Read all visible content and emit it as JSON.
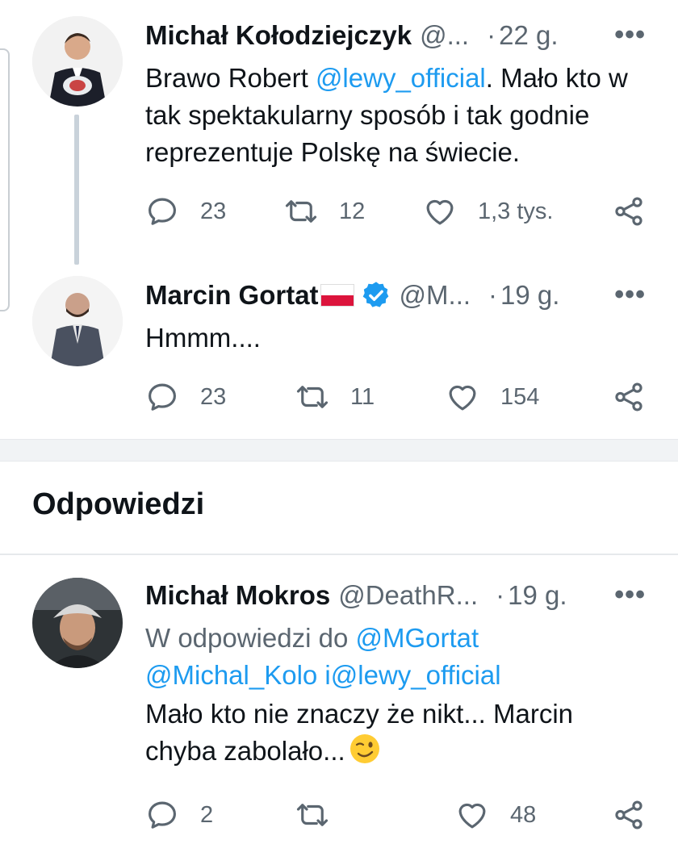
{
  "colors": {
    "link": "#1d9bf0",
    "muted": "#5b6670",
    "text": "#0f1419",
    "verified": "#1d9bf0",
    "flag_red": "#dc143c"
  },
  "tweets": [
    {
      "name": "Michał Kołodziejczyk",
      "handle": "@...",
      "dot": "·",
      "time": "22 g.",
      "more": "•••",
      "text_before": "Brawo Robert ",
      "mention": "@lewy_official",
      "text_after": ". Mało kto w tak spektakularny sposób i tak godnie reprezentuje Polskę na świecie.",
      "replies": "23",
      "retweets": "12",
      "likes": "1,3 tys."
    },
    {
      "name": "Marcin Gortat",
      "handle": "@M...",
      "dot": "·",
      "time": "19 g.",
      "more": "•••",
      "text": "Hmmm....",
      "replies": "23",
      "retweets": "11",
      "likes": "154",
      "flag_icon": "poland-flag-icon",
      "badge_icon": "verified-badge-icon"
    },
    {
      "name": "Michał Mokros",
      "handle": "@DeathR...",
      "dot": "·",
      "time": "19 g.",
      "more": "•••",
      "reply_prefix": "W odpowiedzi do ",
      "reply_mention1": "@MGortat",
      "reply_mention2": "@Michal_Kolo",
      "reply_conj": " i",
      "reply_mention3": "@lewy_official",
      "text": "Mało kto nie znaczy że nikt... Marcin chyba zabolało...",
      "emoji_icon": "winking-face-emoji-icon",
      "replies": "2",
      "retweets": "",
      "likes": "48"
    }
  ],
  "section_title": "Odpowiedzi"
}
